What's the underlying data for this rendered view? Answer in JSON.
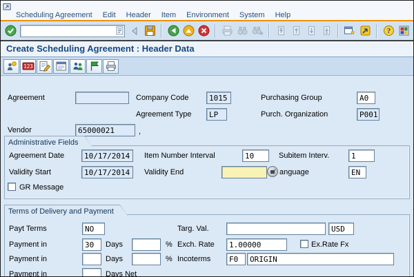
{
  "title": "Create Scheduling Agreement : Header Data",
  "menu": {
    "items": [
      "Scheduling Agreement",
      "Edit",
      "Header",
      "Item",
      "Environment",
      "System",
      "Help"
    ]
  },
  "toolbar": {
    "command_field": {
      "value": ""
    },
    "icons": [
      "enter",
      "save",
      "back",
      "exit",
      "cancel",
      "print",
      "find",
      "find-next",
      "first-page",
      "previous-page",
      "next-page",
      "last-page",
      "new-session",
      "create-shortcut",
      "help",
      "customize-layout"
    ]
  },
  "app_toolbar": {
    "icons": [
      "overview",
      "conditions",
      "editor",
      "text-overview",
      "partners",
      "flag",
      "print-preview"
    ]
  },
  "fields": {
    "agreement": {
      "label": "Agreement",
      "value": ""
    },
    "company_code": {
      "label": "Company Code",
      "value": "1015"
    },
    "purchasing_group": {
      "label": "Purchasing Group",
      "value": "A0"
    },
    "agreement_type": {
      "label": "Agreement Type",
      "value": "LP"
    },
    "purch_organization": {
      "label": "Purch. Organization",
      "value": "P001"
    },
    "vendor": {
      "label": "Vendor",
      "value": "65000021",
      "suffix": ","
    }
  },
  "admin": {
    "section_title": "Administrative Fields",
    "agreement_date": {
      "label": "Agreement Date",
      "value": "10/17/2014"
    },
    "item_number_interval": {
      "label": "Item Number Interval",
      "value": "10"
    },
    "subitem_interval": {
      "label": "Subitem Interv.",
      "value": "1"
    },
    "validity_start": {
      "label": "Validity Start",
      "value": "10/17/2014"
    },
    "validity_end": {
      "label": "Validity End",
      "value": ""
    },
    "language": {
      "label": "anguage",
      "value": "EN"
    },
    "gr_message": {
      "label": "GR Message",
      "checked": false
    }
  },
  "terms": {
    "section_title": "Terms of Delivery and Payment",
    "payt_terms": {
      "label": "Payt Terms",
      "value": "NO"
    },
    "targ_val": {
      "label": "Targ. Val.",
      "value": "",
      "currency": "USD"
    },
    "exch_rate": {
      "label": "Exch. Rate",
      "value": "1.00000"
    },
    "ex_rate_fx": {
      "label": "Ex.Rate Fx",
      "checked": false
    },
    "incoterms": {
      "label": "Incoterms",
      "code": "F0",
      "description": "ORIGIN"
    },
    "payment_rows": [
      {
        "label": "Payment in",
        "days": "30",
        "unit": "Days",
        "percent": "",
        "percent_sign": "%"
      },
      {
        "label": "Payment in",
        "days": "",
        "unit": "Days",
        "percent": "",
        "percent_sign": "%"
      },
      {
        "label": "Payment in",
        "days": "",
        "unit": "Days Net"
      }
    ]
  },
  "colors": {
    "accent_orange": "#f29100",
    "panel_blue": "#dbe8f5",
    "toolbar_blue": "#d3e2f1",
    "app_toolbar_blue": "#c9dcf0",
    "title_text": "#17477f",
    "field_readonly": "#dbe9f8",
    "field_editable": "#ffffff",
    "field_focused": "#f8f2b4"
  }
}
